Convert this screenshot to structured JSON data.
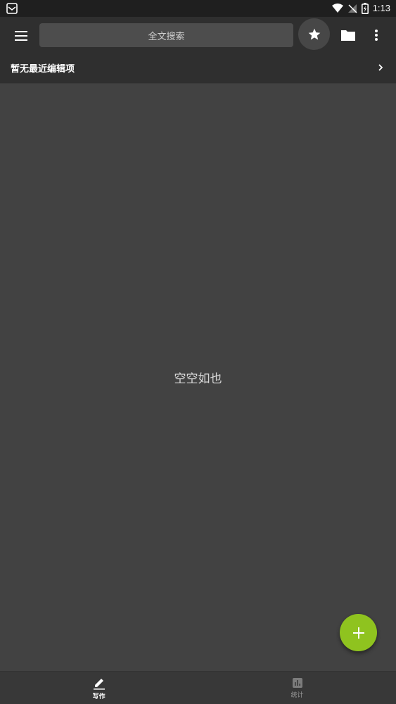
{
  "status_bar": {
    "time": "1:13"
  },
  "toolbar": {
    "search_placeholder": "全文搜索"
  },
  "recent": {
    "label": "暂无最近编辑项"
  },
  "content": {
    "empty_text": "空空如也"
  },
  "bottom_nav": {
    "items": [
      {
        "label": "写作",
        "icon": "pencil-icon",
        "active": true
      },
      {
        "label": "统计",
        "icon": "stats-icon",
        "active": false
      }
    ]
  },
  "colors": {
    "fab": "#8fc31f",
    "background": "#424242",
    "bar": "#2f2f2f"
  }
}
